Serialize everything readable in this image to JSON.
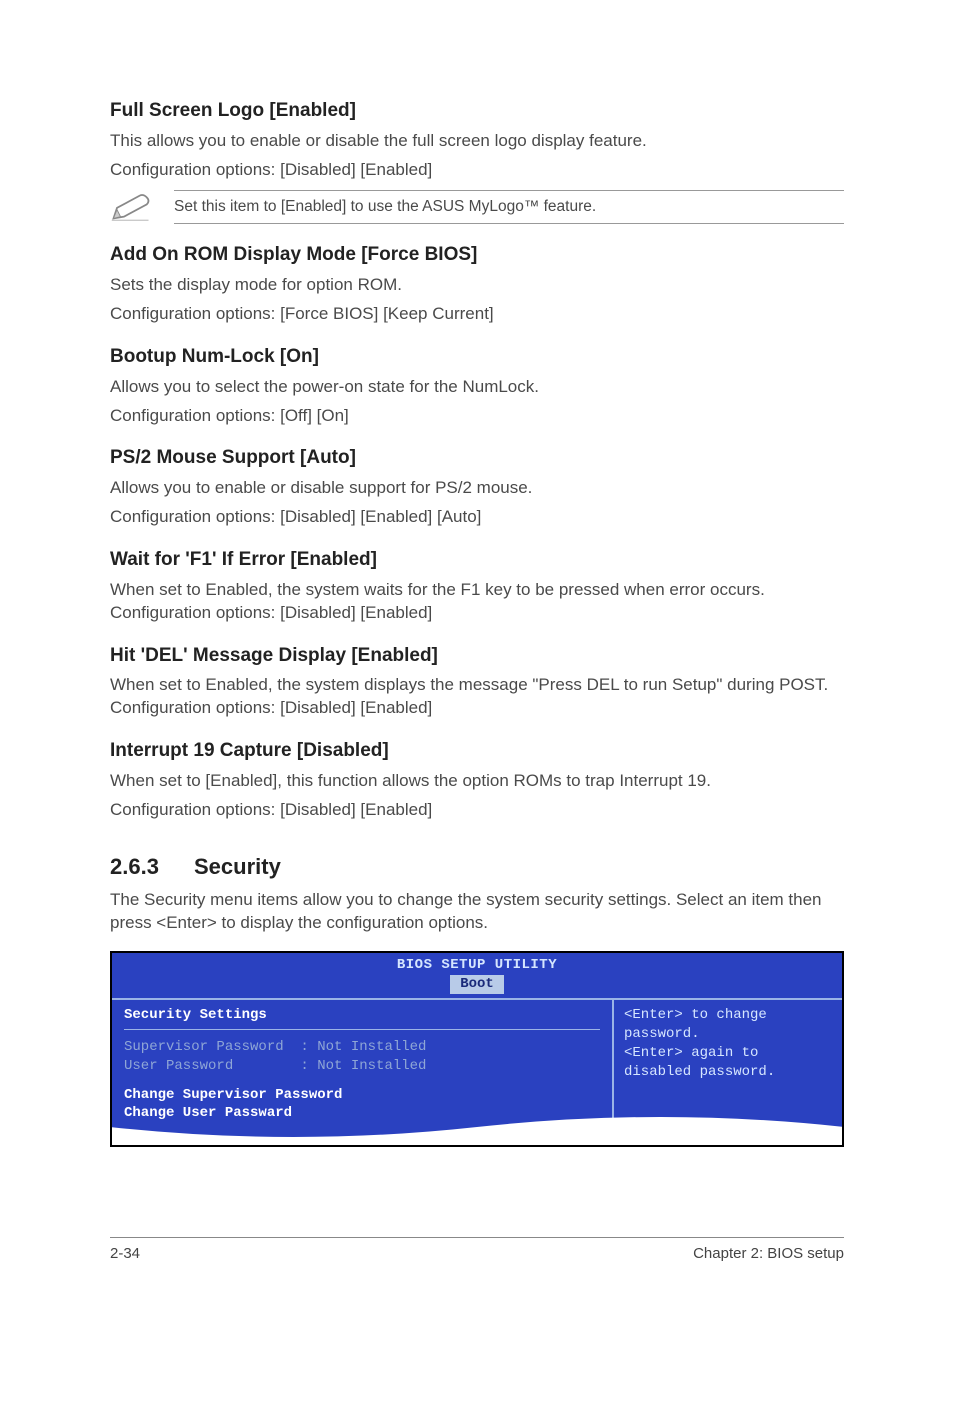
{
  "s1": {
    "title": "Full Screen Logo [Enabled]",
    "p1": "This allows you to enable or disable the full screen logo display feature.",
    "p2": "Configuration options: [Disabled] [Enabled]"
  },
  "note": {
    "text": "Set this item to [Enabled] to use the ASUS MyLogo™ feature."
  },
  "s2": {
    "title": "Add On ROM Display Mode [Force BIOS]",
    "p1": "Sets the display mode for option ROM.",
    "p2": "Configuration options: [Force BIOS] [Keep Current]"
  },
  "s3": {
    "title": "Bootup Num-Lock [On]",
    "p1": "Allows you to select the power-on state for the NumLock.",
    "p2": "Configuration options: [Off] [On]"
  },
  "s4": {
    "title": "PS/2 Mouse Support [Auto]",
    "p1": "Allows you to enable or disable support for PS/2 mouse.",
    "p2": "Configuration options: [Disabled] [Enabled] [Auto]"
  },
  "s5": {
    "title": "Wait for 'F1' If Error [Enabled]",
    "p1": "When set to Enabled, the system waits for the F1 key to be pressed when error occurs. Configuration options: [Disabled] [Enabled]"
  },
  "s6": {
    "title": "Hit 'DEL' Message Display [Enabled]",
    "p1": "When set to Enabled, the system displays the message \"Press DEL to run Setup\" during POST. Configuration options: [Disabled] [Enabled]"
  },
  "s7": {
    "title": "Interrupt 19 Capture [Disabled]",
    "p1": "When set to [Enabled], this function allows the option ROMs to trap Interrupt 19.",
    "p2": "Configuration options: [Disabled] [Enabled]"
  },
  "sec": {
    "num": "2.6.3",
    "title": "Security",
    "p1": "The Security menu items allow you to change the system security settings. Select an item then press <Enter> to display the configuration options."
  },
  "bios": {
    "title": "BIOS SETUP UTILITY",
    "tab": "Boot",
    "heading": "Security Settings",
    "row1": "Supervisor Password  : Not Installed",
    "row2": "User Password        : Not Installed",
    "link1": "Change Supervisor Password",
    "link2": "Change User Passward",
    "help": "<Enter> to change password.\n<Enter> again to disabled password."
  },
  "footer": {
    "left": "2-34",
    "right": "Chapter 2: BIOS setup"
  }
}
